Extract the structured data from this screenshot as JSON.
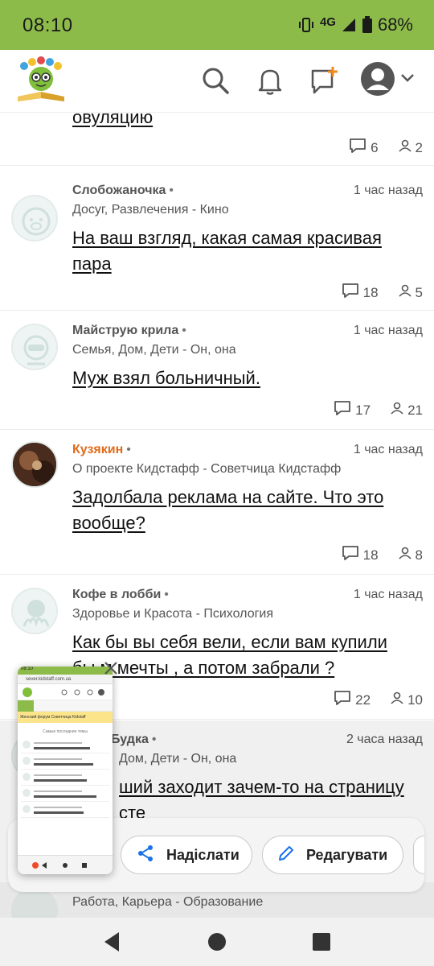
{
  "status_bar": {
    "time": "08:10",
    "network": "4G",
    "battery": "68%",
    "icons": [
      "vibrate-icon",
      "signal-icon",
      "battery-icon"
    ]
  },
  "header": {
    "logo": "kidstaff-logo",
    "icons": [
      "search-icon",
      "bell-icon",
      "new-message-icon",
      "account-avatar-icon",
      "chevron-down-icon"
    ]
  },
  "colors": {
    "accent": "#8dbb4a",
    "orange_author": "#e06b1a"
  },
  "partial_top": {
    "title_fragment": "овуляцию",
    "comments": "6",
    "users": "2"
  },
  "posts": [
    {
      "author": "Слобожаночка",
      "dot": "•",
      "time": "1 час назад",
      "category": "Досуг, Развлечения - Кино",
      "title_lines": [
        "На ваш взгляд, какая самая красивая",
        "пара"
      ],
      "comments": "18",
      "users": "5"
    },
    {
      "author": "Майструю крила",
      "dot": "•",
      "time": "1 час назад",
      "category": "Семья, Дом, Дети - Он, она",
      "title_lines": [
        "Муж взял больничный."
      ],
      "comments": "17",
      "users": "21"
    },
    {
      "author": "Кузякин",
      "dot": "•",
      "time": "1 час назад",
      "category": "О проекте Кидстафф - Советчица Кидстафф",
      "title_lines": [
        "Задолбала реклама на сайте. Что это",
        "вообще?"
      ],
      "comments": "18",
      "users": "8"
    },
    {
      "author": "Кофе в лобби",
      "dot": "•",
      "time": "1 час назад",
      "category": "Здоровье и Красота - Психология",
      "title_lines": [
        "Как бы вы себя вели, если вам купили",
        "бы   м мечты , а потом забрали ?"
      ],
      "comments": "22",
      "users": "10"
    },
    {
      "author": "Будка",
      "dot": "•",
      "time": "2 часа назад",
      "category": "Дом, Дети - Он, она",
      "title_lines": [
        "ший заходит зачем-то на страницу",
        "сте"
      ],
      "comments": "",
      "users": ""
    }
  ],
  "partial_bottom": {
    "category": "Работа, Карьера - Образование"
  },
  "screenshot_overlay": {
    "share_label": "Надіслати",
    "edit_label": "Редагувати"
  },
  "thumbnail": {
    "time": "08:10",
    "url": "sever.kidstaff.com.ua",
    "banner": "Женский форум Советчица Kidstaff",
    "subtitle": "Самые последние темы"
  }
}
